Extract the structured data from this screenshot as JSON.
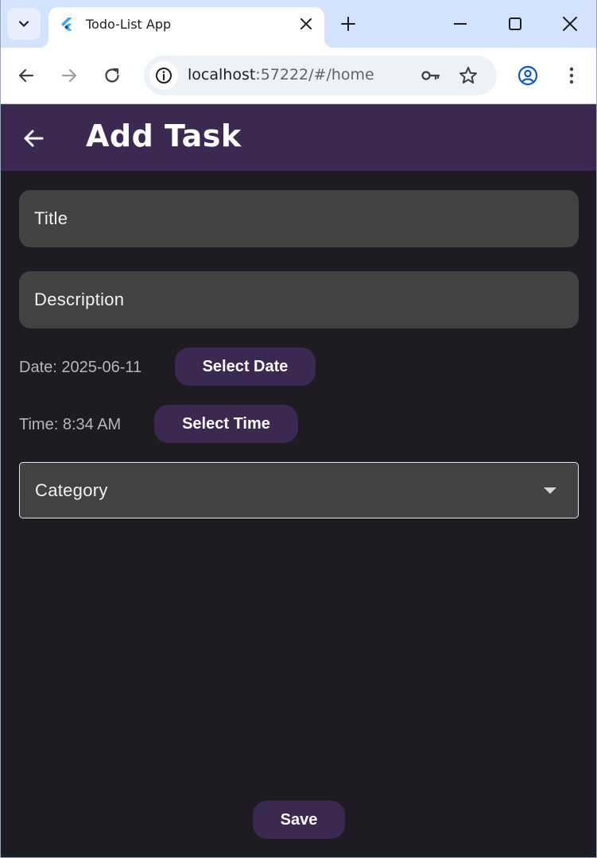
{
  "browser": {
    "tab_title": "Todo-List App",
    "url_host": "localhost",
    "url_rest": ":57222/#/home"
  },
  "app": {
    "title": "Add Task"
  },
  "form": {
    "title_placeholder": "Title",
    "description_placeholder": "Description",
    "date_text": "Date: 2025-06-11",
    "select_date_label": "Select Date",
    "time_text": "Time: 8:34 AM",
    "select_time_label": "Select Time",
    "category_placeholder": "Category",
    "save_label": "Save"
  },
  "colors": {
    "app_bar": "#3b2952",
    "background": "#1e1c22",
    "field": "#424242",
    "tab_strip": "#d3e3fd"
  },
  "icons": {
    "tab_search": "chevron-down-icon",
    "favicon": "flutter-icon",
    "tab_close": "close-icon",
    "new_tab": "plus-icon",
    "minimize": "minimize-icon",
    "maximize": "maximize-icon",
    "close_window": "close-icon",
    "back": "arrow-left-icon",
    "forward": "arrow-right-icon",
    "reload": "reload-icon",
    "site_info": "info-icon",
    "passwords": "key-icon",
    "bookmark": "star-icon",
    "profile": "account-circle-icon",
    "menu": "more-vert-icon",
    "app_back": "arrow-left-icon",
    "category_dropdown": "caret-down-icon"
  }
}
